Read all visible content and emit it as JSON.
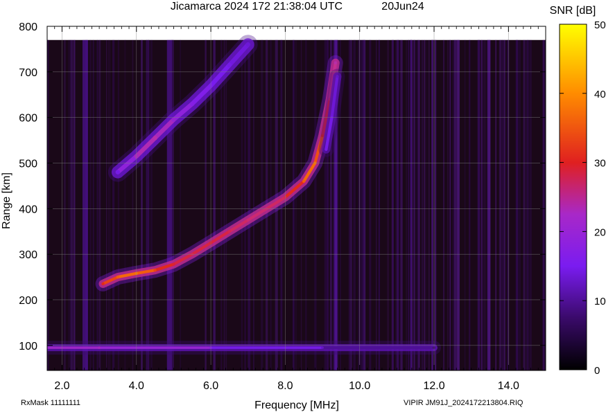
{
  "chart_data": {
    "type": "heatmap",
    "title": "Jicamarca 2024 172 21:38:04 UTC",
    "date_label": "20Jun24",
    "xlabel": "Frequency [MHz]",
    "ylabel": "Range [km]",
    "xlim": [
      1.6,
      15.0
    ],
    "ylim": [
      45,
      800
    ],
    "x_ticks": [
      2.0,
      4.0,
      6.0,
      8.0,
      10.0,
      12.0,
      14.0
    ],
    "x_tick_labels": [
      "2.0",
      "4.0",
      "6.0",
      "8.0",
      "10.0",
      "12.0",
      "14.0"
    ],
    "y_ticks": [
      100,
      200,
      300,
      400,
      500,
      600,
      700,
      800
    ],
    "y_tick_labels": [
      "100",
      "200",
      "300",
      "400",
      "500",
      "600",
      "700",
      "800"
    ],
    "colorbar": {
      "label": "SNR [dB]",
      "range": [
        0,
        50
      ],
      "ticks": [
        0,
        10,
        20,
        30,
        40,
        50
      ],
      "tick_labels": [
        "0",
        "10",
        "20",
        "30",
        "40",
        "50"
      ],
      "colors": [
        "#000000",
        "#3a0a6a",
        "#7a1cf0",
        "#c030a0",
        "#e02020",
        "#ff8c00",
        "#ffff00"
      ]
    },
    "grid": true,
    "traces": [
      {
        "role": "o-trace-F",
        "freq": [
          3.1,
          3.5,
          4.0,
          4.5,
          5.0,
          5.5,
          6.0,
          6.5,
          7.0,
          7.5,
          8.0,
          8.5,
          8.8,
          9.0,
          9.2,
          9.35
        ],
        "range": [
          235,
          250,
          258,
          265,
          278,
          300,
          325,
          350,
          375,
          400,
          425,
          460,
          500,
          560,
          640,
          720
        ],
        "snr": [
          34,
          38,
          40,
          36,
          32,
          30,
          32,
          30,
          28,
          28,
          30,
          38,
          40,
          34,
          28,
          24
        ]
      },
      {
        "role": "x-trace",
        "freq": [
          9.1,
          9.25,
          9.4
        ],
        "range": [
          530,
          600,
          690
        ],
        "snr": [
          16,
          16,
          14
        ]
      },
      {
        "role": "multihop",
        "freq": [
          3.5,
          4.0,
          4.5,
          5.0,
          5.5,
          6.0,
          6.5,
          7.0
        ],
        "range": [
          480,
          515,
          555,
          595,
          630,
          670,
          715,
          760
        ],
        "snr": [
          16,
          22,
          24,
          20,
          18,
          17,
          16,
          15
        ]
      },
      {
        "role": "sporadic-E",
        "freq": [
          1.6,
          3.0,
          6.0,
          9.0,
          12.0
        ],
        "range": [
          95,
          95,
          95,
          95,
          95
        ],
        "snr": [
          20,
          22,
          18,
          14,
          8
        ]
      }
    ]
  },
  "footer": {
    "left": "RxMask 11111111",
    "right": "VIPIR  JM91J_2024172213804.RIQ"
  }
}
